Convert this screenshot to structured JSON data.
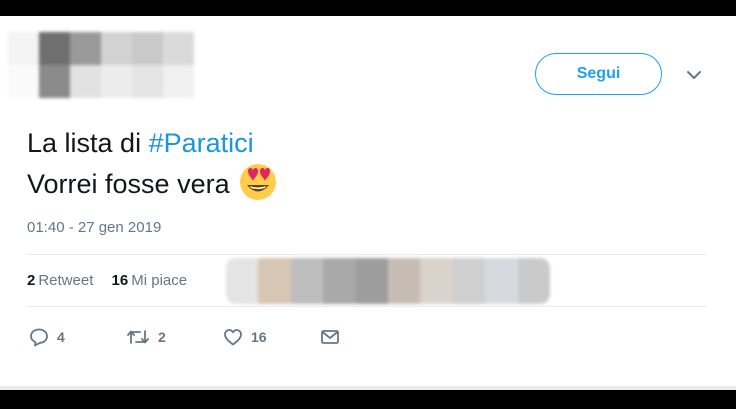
{
  "tweet": {
    "follow_label": "Segui",
    "text_prefix": "La lista di ",
    "hashtag": "#Paratici",
    "text_line2": "Vorrei fosse vera",
    "emoji": "smiling-face-with-heart-eyes",
    "timestamp": "01:40 - 27 gen 2019",
    "stats": {
      "retweet_count": "2",
      "retweet_label": "Retweet",
      "like_count": "16",
      "like_label": "Mi piace"
    },
    "actions": {
      "reply_count": "4",
      "retweet_count": "2",
      "like_count": "16"
    },
    "accent_color": "#1da1f2"
  }
}
